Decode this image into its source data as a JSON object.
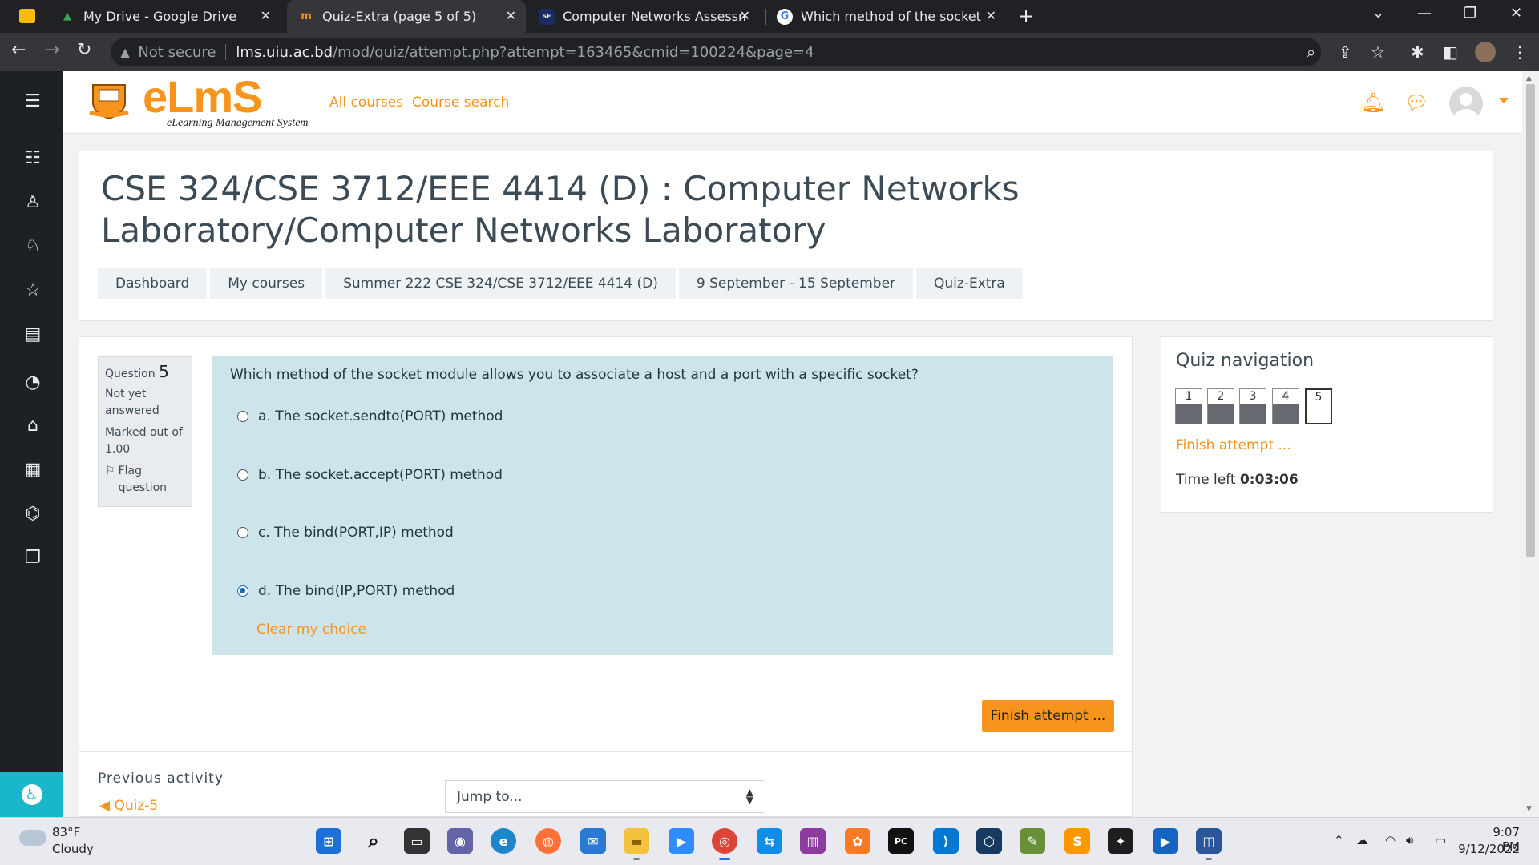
{
  "browser": {
    "tabs": [
      {
        "title": "My Drive - Google Drive",
        "active": false
      },
      {
        "title": "Quiz-Extra (page 5 of 5)",
        "active": true
      },
      {
        "title": "Computer Networks Assessment",
        "active": false
      },
      {
        "title": "Which method of the socket mod",
        "active": false
      }
    ],
    "address": {
      "security": "Not secure",
      "host": "lms.uiu.ac.bd",
      "path": "/mod/quiz/attempt.php?attempt=163465&cmid=100224&page=4"
    }
  },
  "navbar": {
    "logo_word": "eLmS",
    "logo_sub": "eLearning Management System",
    "links": [
      "All courses",
      "Course search"
    ]
  },
  "page": {
    "title": "CSE 324/CSE 3712/EEE 4414 (D) : Computer Networks Laboratory/Computer Networks Laboratory",
    "breadcrumb": [
      "Dashboard",
      "My courses",
      "Summer 222 CSE 324/CSE 3712/EEE 4414 (D)",
      "9 September - 15 September",
      "Quiz-Extra"
    ]
  },
  "question": {
    "label": "Question",
    "number": "5",
    "status": "Not yet answered",
    "marked": "Marked out of 1.00",
    "flag": "Flag question",
    "text": "Which method of the socket module allows you to associate a host and a port with a specific socket?",
    "options": [
      {
        "label": "a. The socket.sendto(PORT) method",
        "selected": false
      },
      {
        "label": "b. The socket.accept(PORT) method",
        "selected": false
      },
      {
        "label": "c. The bind(PORT,IP) method",
        "selected": false
      },
      {
        "label": "d. The bind(IP,PORT) method",
        "selected": true
      }
    ],
    "clear": "Clear my choice"
  },
  "actions": {
    "finish": "Finish attempt ...",
    "previous_label": "Previous activity",
    "previous_link": "◀ Quiz-5",
    "jump_placeholder": "Jump to..."
  },
  "quiz_nav": {
    "title": "Quiz navigation",
    "buttons": [
      "1",
      "2",
      "3",
      "4",
      "5"
    ],
    "current": "5",
    "finish": "Finish attempt ...",
    "time_label": "Time left",
    "time_value": "0:03:06"
  },
  "taskbar": {
    "temp": "83°F",
    "condition": "Cloudy",
    "time": "9:07 PM",
    "date": "9/12/2022"
  },
  "colors": {
    "accent": "#f7941d",
    "question_bg": "#cde5ea",
    "rail": "#1d2125"
  }
}
